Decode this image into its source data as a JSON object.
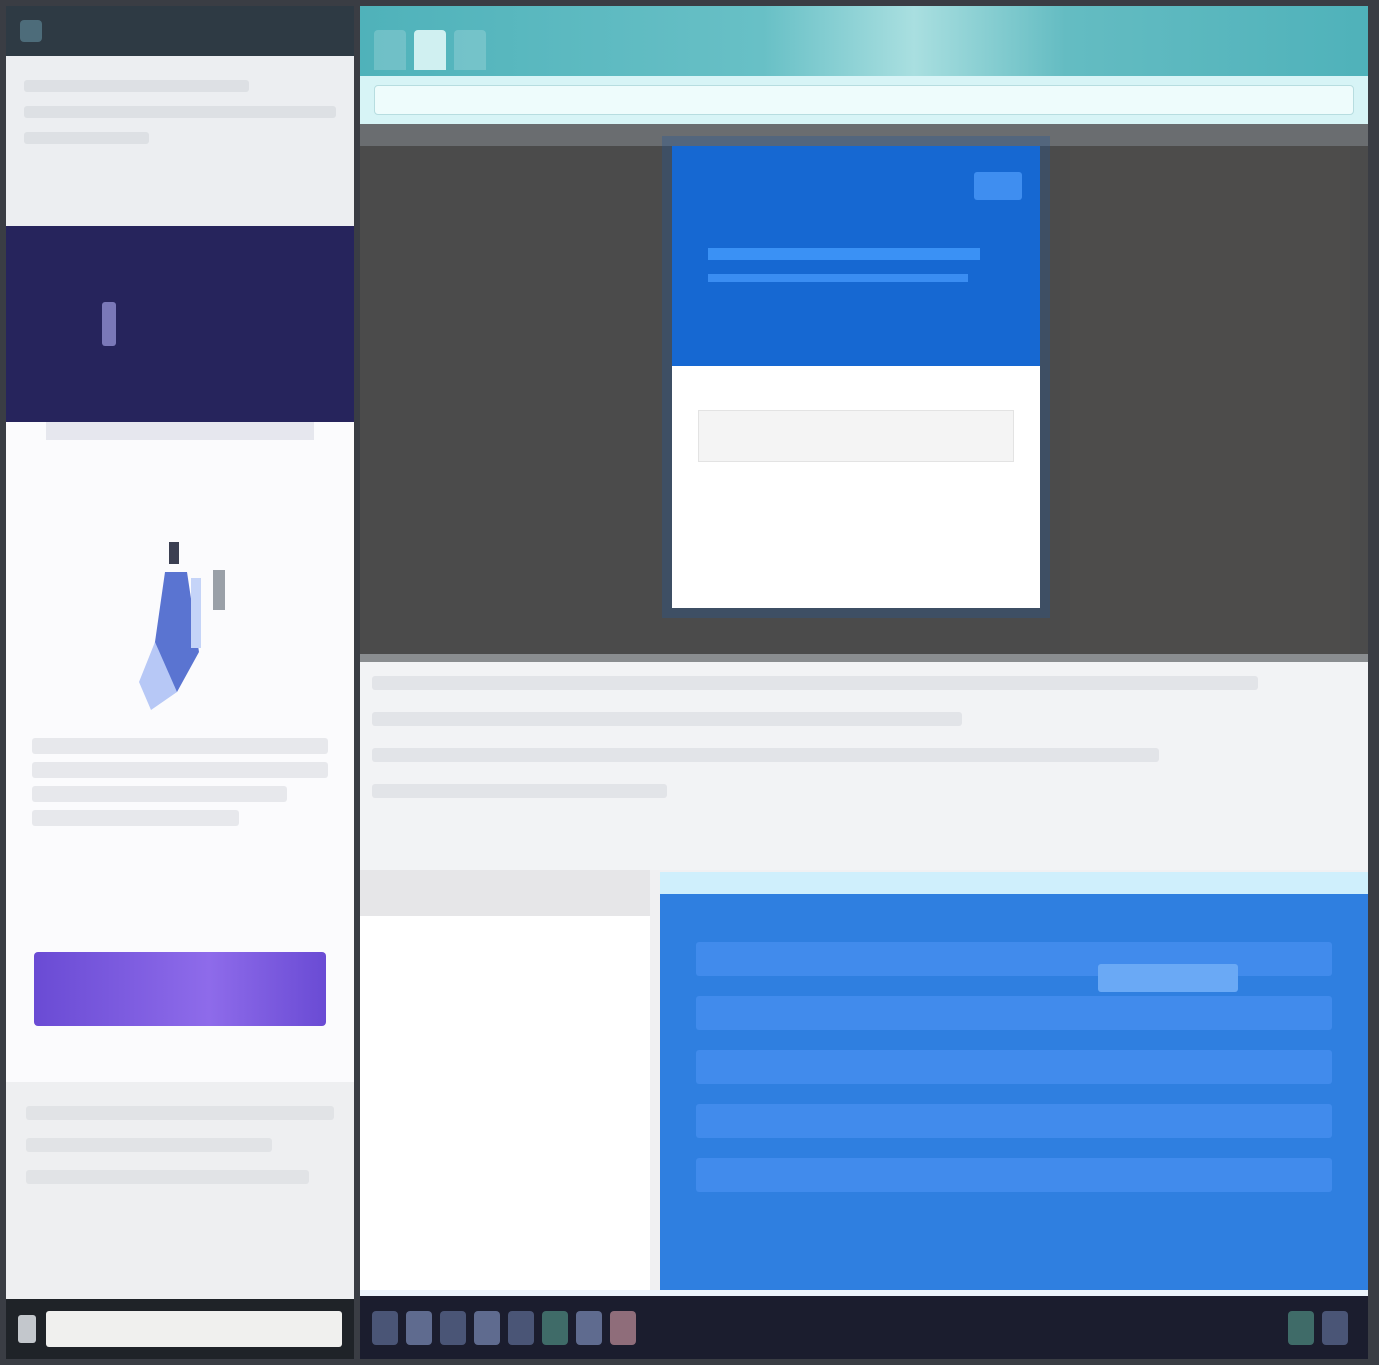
{
  "left_panel": {
    "brand_name": "",
    "cta_label": ""
  },
  "browser": {
    "tabs": [
      "",
      "",
      ""
    ],
    "address": ""
  },
  "stage": {
    "logo_text": "",
    "modal": {
      "title": "",
      "subtitle": "",
      "field_label": "",
      "field_placeholder": ""
    }
  },
  "taskbar": {
    "clock": ""
  },
  "colors": {
    "brand_bar": "#26245c",
    "cta": "#7b5ae0",
    "browser_chrome": "#4fb2ba",
    "modal_header": "#1668d2",
    "lower_panel": "#2f7fe0",
    "taskbar": "#1b1d2e"
  },
  "icons": [
    "app-icon",
    "brand-logo-icon",
    "illustration-icon",
    "close-icon",
    "taskbar-app-icon"
  ]
}
